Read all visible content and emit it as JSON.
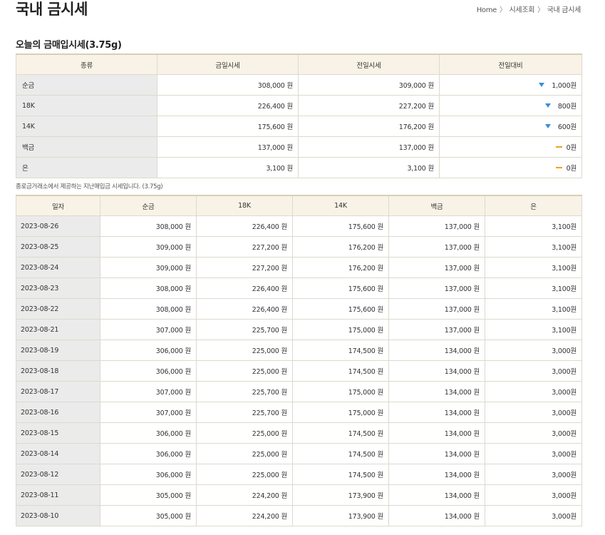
{
  "header": {
    "title": "국내 금시세",
    "breadcrumb": [
      "Home",
      "시세조회",
      "국내 금시세"
    ]
  },
  "today": {
    "section_title": "오늘의 금매입시세(3.75g)",
    "columns": [
      "종류",
      "금일시세",
      "전일시세",
      "전일대비"
    ],
    "rows": [
      {
        "type": "순금",
        "today": "308,000 원",
        "prev": "309,000 원",
        "change": "1,000원",
        "dir": "down"
      },
      {
        "type": "18K",
        "today": "226,400 원",
        "prev": "227,200 원",
        "change": "800원",
        "dir": "down"
      },
      {
        "type": "14K",
        "today": "175,600 원",
        "prev": "176,200 원",
        "change": "600원",
        "dir": "down"
      },
      {
        "type": "백금",
        "today": "137,000 원",
        "prev": "137,000 원",
        "change": "0원",
        "dir": "same"
      },
      {
        "type": "은",
        "today": "3,100 원",
        "prev": "3,100 원",
        "change": "0원",
        "dir": "same"
      }
    ]
  },
  "note": "종로금거래소에서 제공하는 지난매입금 시세입니다. (3.75g)",
  "history": {
    "columns": [
      "일자",
      "순금",
      "18K",
      "14K",
      "백금",
      "은"
    ],
    "rows": [
      [
        "2023-08-26",
        "308,000 원",
        "226,400 원",
        "175,600 원",
        "137,000 원",
        "3,100원"
      ],
      [
        "2023-08-25",
        "309,000 원",
        "227,200 원",
        "176,200 원",
        "137,000 원",
        "3,100원"
      ],
      [
        "2023-08-24",
        "309,000 원",
        "227,200 원",
        "176,200 원",
        "137,000 원",
        "3,100원"
      ],
      [
        "2023-08-23",
        "308,000 원",
        "226,400 원",
        "175,600 원",
        "137,000 원",
        "3,100원"
      ],
      [
        "2023-08-22",
        "308,000 원",
        "226,400 원",
        "175,600 원",
        "137,000 원",
        "3,100원"
      ],
      [
        "2023-08-21",
        "307,000 원",
        "225,700 원",
        "175,000 원",
        "137,000 원",
        "3,100원"
      ],
      [
        "2023-08-19",
        "306,000 원",
        "225,000 원",
        "174,500 원",
        "134,000 원",
        "3,000원"
      ],
      [
        "2023-08-18",
        "306,000 원",
        "225,000 원",
        "174,500 원",
        "134,000 원",
        "3,000원"
      ],
      [
        "2023-08-17",
        "307,000 원",
        "225,700 원",
        "175,000 원",
        "134,000 원",
        "3,000원"
      ],
      [
        "2023-08-16",
        "307,000 원",
        "225,700 원",
        "175,000 원",
        "134,000 원",
        "3,000원"
      ],
      [
        "2023-08-15",
        "306,000 원",
        "225,000 원",
        "174,500 원",
        "134,000 원",
        "3,000원"
      ],
      [
        "2023-08-14",
        "306,000 원",
        "225,000 원",
        "174,500 원",
        "134,000 원",
        "3,000원"
      ],
      [
        "2023-08-12",
        "306,000 원",
        "225,000 원",
        "174,500 원",
        "134,000 원",
        "3,000원"
      ],
      [
        "2023-08-11",
        "305,000 원",
        "224,200 원",
        "173,900 원",
        "134,000 원",
        "3,000원"
      ],
      [
        "2023-08-10",
        "305,000 원",
        "224,200 원",
        "173,900 원",
        "134,000 원",
        "3,000원"
      ]
    ]
  },
  "colors": {
    "header_bg": "#f8f3e6",
    "label_bg": "#ebebeb",
    "down": "#3a8fd8",
    "same": "#f0a020"
  },
  "icons": {
    "down": "triangle-down-icon",
    "same": "dash-icon"
  }
}
